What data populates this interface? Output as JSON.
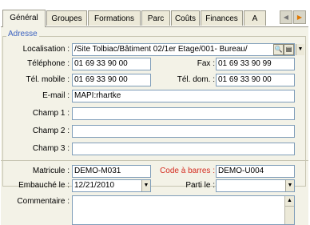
{
  "tabs": [
    "Général",
    "Groupes",
    "Formations",
    "Parc",
    "Coûts",
    "Finances",
    "A"
  ],
  "group_title": "Adresse",
  "labels": {
    "localisation": "Localisation :",
    "telephone": "Téléphone :",
    "fax": "Fax :",
    "tel_mobile": "Tél. mobile :",
    "tel_dom": "Tél. dom. :",
    "email": "E-mail :",
    "champ1": "Champ 1 :",
    "champ2": "Champ 2 :",
    "champ3": "Champ 3 :",
    "matricule": "Matricule :",
    "code_barres": "Code à barres :",
    "embauche": "Embauché le :",
    "parti": "Parti le :",
    "commentaire": "Commentaire :"
  },
  "values": {
    "localisation": "/Site Tolbiac/Bâtiment 02/1er Etage/001- Bureau/",
    "telephone": "01 69 33 90 00",
    "fax": "01 69 33 90 99",
    "tel_mobile": "01 69 33 90 00",
    "tel_dom": "01 69 33 90 00",
    "email": "MAPI:rhartke",
    "champ1": "",
    "champ2": "",
    "champ3": "",
    "matricule": "DEMO-M031",
    "code_barres": "DEMO-U004",
    "embauche": "12/21/2010",
    "parti": "",
    "commentaire": ""
  },
  "icons": {
    "search": "search-icon",
    "detail": "detail-icon",
    "dropdown": "chevron-down-icon",
    "scroll_left": "chevron-left-icon",
    "scroll_right": "chevron-right-icon",
    "scroll_up": "scroll-up-icon"
  },
  "colors": {
    "group_title": "#3c63c0",
    "required_label": "#d42a1e",
    "active_arrow": "#e07800"
  }
}
